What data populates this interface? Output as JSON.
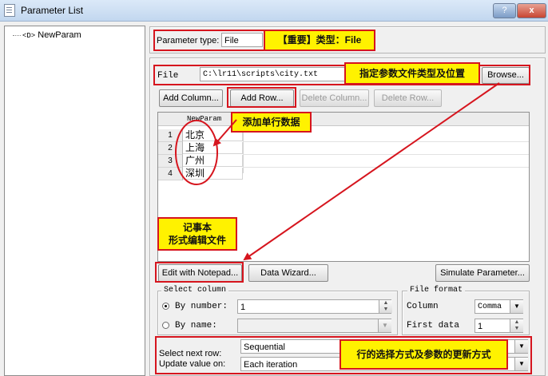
{
  "window": {
    "title": "Parameter List",
    "help_label": "?",
    "close_label": "x"
  },
  "tree": {
    "item_icon": "<D>",
    "item_label": "NewParam"
  },
  "param_type": {
    "label": "Parameter type:",
    "value": "File"
  },
  "file": {
    "label": "File",
    "path": "C:\\lr11\\scripts\\city.txt",
    "browse_label": "Browse..."
  },
  "buttons": {
    "add_column": "Add Column...",
    "add_row": "Add Row...",
    "delete_column": "Delete Column...",
    "delete_row": "Delete Row...",
    "edit_notepad": "Edit with Notepad...",
    "data_wizard": "Data Wizard...",
    "simulate": "Simulate Parameter..."
  },
  "grid": {
    "column_header": "NewParam",
    "rows": [
      {
        "num": "1",
        "value": "北京"
      },
      {
        "num": "2",
        "value": "上海"
      },
      {
        "num": "3",
        "value": "广州"
      },
      {
        "num": "4",
        "value": "深圳"
      }
    ]
  },
  "select_column": {
    "title": "Select column",
    "by_number_label": "By number:",
    "by_number_value": "1",
    "by_name_label": "By name:"
  },
  "file_format": {
    "title": "File format",
    "column_label": "Column",
    "column_value": "Comma",
    "first_data_label": "First data",
    "first_data_value": "1"
  },
  "next_row": {
    "label": "Select next row:",
    "value": "Sequential"
  },
  "update_value": {
    "label": "Update value on:",
    "value": "Each iteration"
  },
  "annotations": {
    "type_note": "【重要】类型：File",
    "file_note": "指定参数文件类型及位置",
    "add_row_note": "添加单行数据",
    "notepad_note_line1": "记事本",
    "notepad_note_line2": "形式编辑文件",
    "update_note": "行的选择方式及参数的更新方式"
  },
  "colors": {
    "callout_fill": "#fff200",
    "callout_border": "#d6151e",
    "arrow": "#d6151e"
  }
}
